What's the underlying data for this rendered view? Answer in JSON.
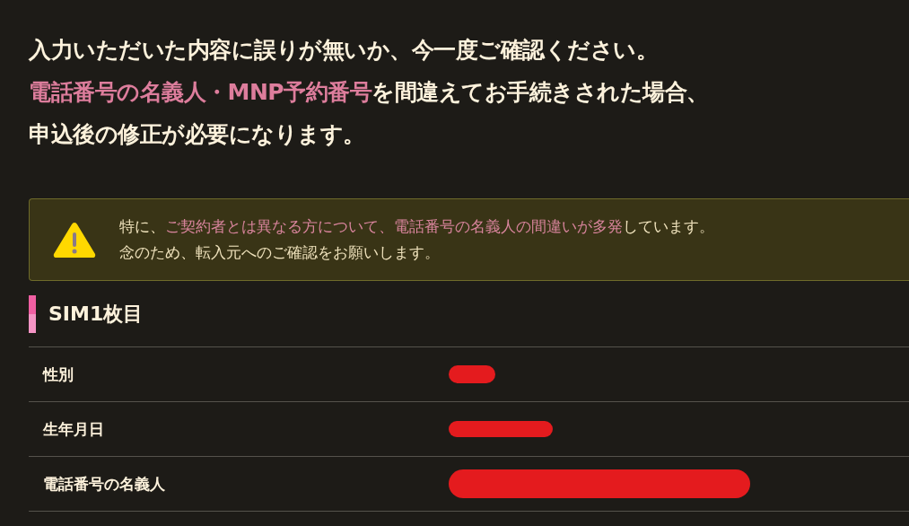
{
  "intro": [
    "入力いただいた内容に誤りが無いか、今一度ご確認ください。",
    "**電話番号の名義人・MNP予約番号**を間違えてお手続きされた場合、",
    "申込後の修正が必要になります。"
  ],
  "notice": {
    "lines": [
      "特に、**ご契約者とは異なる方について、電話番号の名義人の間違いが多発**しています。",
      "念のため、転入元へのご確認をお願いします。"
    ]
  },
  "section": {
    "title": "SIM1枚目",
    "rows": [
      {
        "label": "性別",
        "redacted": true
      },
      {
        "label": "生年月日",
        "redacted": true
      },
      {
        "label": "電話番号の名義人",
        "redacted": true
      }
    ]
  }
}
